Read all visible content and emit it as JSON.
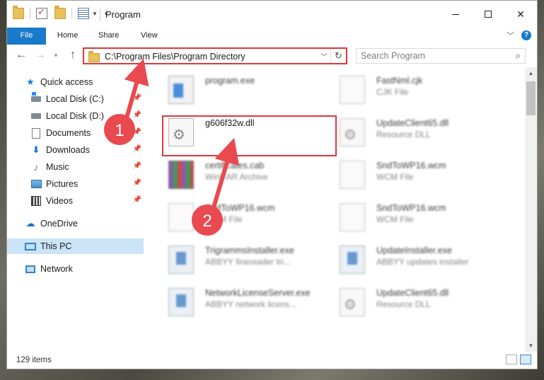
{
  "window": {
    "title": "Program"
  },
  "ribbon": {
    "tabs": [
      "File",
      "Home",
      "Share",
      "View"
    ]
  },
  "navigation": {
    "address_path": "C:\\Program Files\\Program Directory",
    "search_placeholder": "Search Program"
  },
  "sidebar": {
    "items": [
      {
        "label": "Quick access",
        "icon": "star-icon",
        "pinned": false
      },
      {
        "label": "Local Disk (C:)",
        "icon": "local-disk-icon",
        "pinned": true
      },
      {
        "label": "Local Disk (D:)",
        "icon": "local-disk-icon",
        "pinned": true
      },
      {
        "label": "Documents",
        "icon": "documents-icon",
        "pinned": true
      },
      {
        "label": "Downloads",
        "icon": "downloads-icon",
        "pinned": true
      },
      {
        "label": "Music",
        "icon": "music-icon",
        "pinned": true
      },
      {
        "label": "Pictures",
        "icon": "pictures-icon",
        "pinned": true
      },
      {
        "label": "Videos",
        "icon": "videos-icon",
        "pinned": true
      },
      {
        "label": "OneDrive",
        "icon": "onedrive-icon",
        "pinned": false
      },
      {
        "label": "This PC",
        "icon": "this-pc-icon",
        "pinned": false,
        "selected": true
      },
      {
        "label": "Network",
        "icon": "network-icon",
        "pinned": false
      }
    ]
  },
  "files": [
    {
      "name": "program.exe",
      "type": "",
      "icon": "exe-icon",
      "blurred": true
    },
    {
      "name": "FastNml.cjk",
      "type": "CJK File",
      "icon": "file-icon",
      "blurred": true
    },
    {
      "name": "g606f32w.dll",
      "type": "",
      "icon": "dll-gear-icon",
      "blurred": false,
      "highlighted": true
    },
    {
      "name": "UpdateClient65.dll",
      "type": "Resource DLL",
      "icon": "dll-gear-icon",
      "blurred": true
    },
    {
      "name": "certificates.cab",
      "type": "WinRAR Archive",
      "icon": "winrar-icon",
      "blurred": true
    },
    {
      "name": "SndToWP16.wcm",
      "type": "WCM File",
      "icon": "file-icon",
      "blurred": true
    },
    {
      "name": "SndToWP16.wcm",
      "type": "WCM File",
      "icon": "file-icon",
      "blurred": true
    },
    {
      "name": "SndToWP16.wcm",
      "type": "WCM File",
      "icon": "file-icon",
      "blurred": true
    },
    {
      "name": "TrigrammsInstaller.exe",
      "type": "ABBYY finereader tri...",
      "icon": "installer-icon",
      "blurred": true
    },
    {
      "name": "UpdateInstaller.exe",
      "type": "ABBYY updates installer",
      "icon": "installer-icon",
      "blurred": true
    },
    {
      "name": "NetworkLicenseServer.exe",
      "type": "ABBYY network licens...",
      "icon": "installer-icon",
      "blurred": true
    },
    {
      "name": "UpdateClient65.dll",
      "type": "Resource DLL",
      "icon": "dll-gear-icon",
      "blurred": true
    }
  ],
  "status": {
    "item_count": "129 items"
  },
  "annotations": {
    "step1": "1",
    "step2": "2",
    "color": "#e84a4f"
  }
}
